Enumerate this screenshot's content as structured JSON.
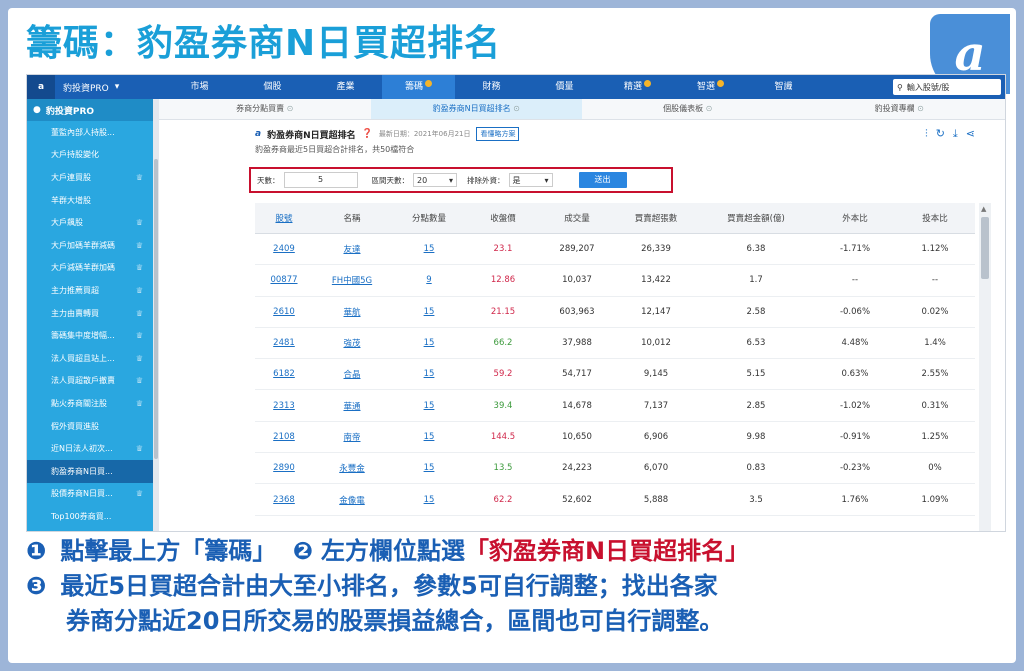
{
  "hero": {
    "title": "籌碼：豹盈券商N日買超排名",
    "logo_glyph": "a"
  },
  "topnav": {
    "brand_glyph": "a",
    "brand_name": "豹投資PRO",
    "items": [
      {
        "label": "市場",
        "dot": false,
        "active": false
      },
      {
        "label": "個股",
        "dot": false,
        "active": false
      },
      {
        "label": "產業",
        "dot": false,
        "active": false
      },
      {
        "label": "籌碼",
        "dot": true,
        "active": true
      },
      {
        "label": "財務",
        "dot": false,
        "active": false
      },
      {
        "label": "價量",
        "dot": false,
        "active": false
      },
      {
        "label": "精選",
        "dot": true,
        "active": false
      },
      {
        "label": "智選",
        "dot": true,
        "active": false
      },
      {
        "label": "智識",
        "dot": false,
        "active": false
      }
    ],
    "search_placeholder": "輸入股號/股"
  },
  "sidebar": {
    "header": "豹投資PRO",
    "items": [
      {
        "label": "董監內部人持股...",
        "locked": false,
        "active": false
      },
      {
        "label": "大戶持股變化",
        "locked": false,
        "active": false
      },
      {
        "label": "大戶連買股",
        "locked": true,
        "active": false
      },
      {
        "label": "羊群大增股",
        "locked": false,
        "active": false
      },
      {
        "label": "大戶飆股",
        "locked": true,
        "active": false
      },
      {
        "label": "大戶加碼羊群減碼",
        "locked": true,
        "active": false
      },
      {
        "label": "大戶減碼羊群加碼",
        "locked": true,
        "active": false
      },
      {
        "label": "主力推薦買超",
        "locked": true,
        "active": false
      },
      {
        "label": "主力由賣轉買",
        "locked": true,
        "active": false
      },
      {
        "label": "籌碼集中度增幅...",
        "locked": true,
        "active": false
      },
      {
        "label": "法人買超且站上...",
        "locked": true,
        "active": false
      },
      {
        "label": "法人買超散戶撤賣",
        "locked": true,
        "active": false
      },
      {
        "label": "點火券商關注股",
        "locked": true,
        "active": false
      },
      {
        "label": "假外資買進股",
        "locked": false,
        "active": false
      },
      {
        "label": "近N日法人初次...",
        "locked": true,
        "active": false
      },
      {
        "label": "豹盈券商N日買...",
        "locked": false,
        "active": true
      },
      {
        "label": "股價券商N日買...",
        "locked": true,
        "active": false
      },
      {
        "label": "Top100券商買...",
        "locked": false,
        "active": false
      }
    ]
  },
  "subtabs": [
    {
      "label": "券商分點買賣",
      "active": false
    },
    {
      "label": "豹盈券商N日買超排名",
      "active": true
    },
    {
      "label": "個股儀表板",
      "active": false
    },
    {
      "label": "豹投資專欄",
      "active": false
    }
  ],
  "page": {
    "title": "豹盈券商N日買超排名",
    "update": "最新日期：2021年06月21日",
    "strategy_btn": "看懂略方案",
    "subtitle": "豹盈券商最近5日買超合計排名，共50檔符合"
  },
  "filter": {
    "days_label": "天數：",
    "days_value": "5",
    "range_label": "區間天數：",
    "range_value": "20",
    "exclude_label": "排除外資：",
    "exclude_value": "是",
    "submit": "送出"
  },
  "table": {
    "headers": [
      "股號",
      "名稱",
      "分點數量",
      "收盤價",
      "成交量",
      "買賣超張數",
      "買賣超金額(億)",
      "外本比",
      "投本比"
    ],
    "rows": [
      {
        "code": "2409",
        "name": "友達",
        "branches": "15",
        "close": "23.1",
        "dir": "red",
        "volume": "289,207",
        "net": "26,339",
        "amount": "6.38",
        "foreign": "-1.71%",
        "trust": "1.12%"
      },
      {
        "code": "00877",
        "name": "FH中國5G",
        "branches": "9",
        "close": "12.86",
        "dir": "red",
        "volume": "10,037",
        "net": "13,422",
        "amount": "1.7",
        "foreign": "--",
        "trust": "--"
      },
      {
        "code": "2610",
        "name": "華航",
        "branches": "15",
        "close": "21.15",
        "dir": "red",
        "volume": "603,963",
        "net": "12,147",
        "amount": "2.58",
        "foreign": "-0.06%",
        "trust": "0.02%"
      },
      {
        "code": "2481",
        "name": "強茂",
        "branches": "15",
        "close": "66.2",
        "dir": "green",
        "volume": "37,988",
        "net": "10,012",
        "amount": "6.53",
        "foreign": "4.48%",
        "trust": "1.4%"
      },
      {
        "code": "6182",
        "name": "合晶",
        "branches": "15",
        "close": "59.2",
        "dir": "red",
        "volume": "54,717",
        "net": "9,145",
        "amount": "5.15",
        "foreign": "0.63%",
        "trust": "2.55%"
      },
      {
        "code": "2313",
        "name": "華通",
        "branches": "15",
        "close": "39.4",
        "dir": "green",
        "volume": "14,678",
        "net": "7,137",
        "amount": "2.85",
        "foreign": "-1.02%",
        "trust": "0.31%"
      },
      {
        "code": "2108",
        "name": "南帝",
        "branches": "15",
        "close": "144.5",
        "dir": "red",
        "volume": "10,650",
        "net": "6,906",
        "amount": "9.98",
        "foreign": "-0.91%",
        "trust": "1.25%"
      },
      {
        "code": "2890",
        "name": "永豐金",
        "branches": "15",
        "close": "13.5",
        "dir": "green",
        "volume": "24,223",
        "net": "6,070",
        "amount": "0.83",
        "foreign": "-0.23%",
        "trust": "0%"
      },
      {
        "code": "2368",
        "name": "金像電",
        "branches": "15",
        "close": "62.2",
        "dir": "red",
        "volume": "52,602",
        "net": "5,888",
        "amount": "3.5",
        "foreign": "1.76%",
        "trust": "1.09%"
      }
    ]
  },
  "instructions": {
    "step1_num": "❶",
    "step1_text": "點擊最上方「籌碼」",
    "step2_num": "❷",
    "step2_text": "左方欄位點選",
    "step2_highlight": "「豹盈券商N日買超排名」",
    "step3_num": "❸",
    "step3_line1": "最近5日買超合計由大至小排名，參數5可自行調整；找出各家",
    "step3_line2": "券商分點近20日所交易的股票損益總合，區間也可自行調整。"
  },
  "colors": {
    "accent": "#1a5fb4",
    "highlight": "#c8102e",
    "up": "#d0284b",
    "down": "#3c9a3c"
  }
}
